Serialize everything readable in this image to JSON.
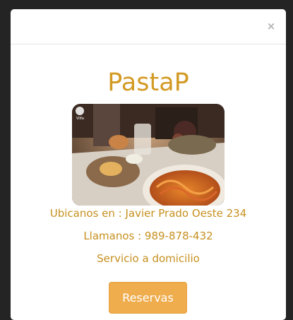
{
  "modal": {
    "close_label": "×",
    "title": "PastaP",
    "photo_alt": "Foto del restaurante",
    "photo_badge": "Vilfa",
    "address_line": "Ubicanos en : Javier Prado Oeste 234",
    "phone_line": "Llamanos : 989-878-432",
    "service_line": "Servicio a domicilio",
    "reserve_label": "Reservas"
  },
  "colors": {
    "accent": "#d39a24",
    "button": "#efad4e",
    "backdrop": "#242424"
  }
}
